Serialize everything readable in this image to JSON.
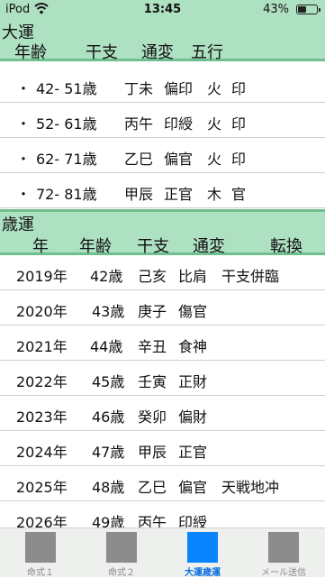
{
  "status_bar": {
    "carrier": "iPod",
    "time": "13:45",
    "battery_percent": "43%",
    "battery_level": 0.43,
    "wifi_icon": "wifi-icon",
    "battery_icon": "battery-icon"
  },
  "major_luck": {
    "title": "大運",
    "headers": [
      "年齢",
      "干支",
      "通変",
      "五行"
    ],
    "rows": [
      {
        "bullet": "・",
        "age": "42- 51歳",
        "kanshi": "丁未",
        "tsuhen": "偏印",
        "gogyo1": "火",
        "gogyo2": "印"
      },
      {
        "bullet": "・",
        "age": "52- 61歳",
        "kanshi": "丙午",
        "tsuhen": "印綬",
        "gogyo1": "火",
        "gogyo2": "印"
      },
      {
        "bullet": "・",
        "age": "62- 71歳",
        "kanshi": "乙巳",
        "tsuhen": "偏官",
        "gogyo1": "火",
        "gogyo2": "印"
      },
      {
        "bullet": "・",
        "age": "72- 81歳",
        "kanshi": "甲辰",
        "tsuhen": "正官",
        "gogyo1": "木",
        "gogyo2": "官"
      }
    ]
  },
  "annual_luck": {
    "title": "歳運",
    "headers": [
      "年",
      "年齢",
      "干支",
      "通変",
      "転換"
    ],
    "rows": [
      {
        "year": "2019年",
        "age": "42歳",
        "kanshi": "己亥",
        "tsuhen": "比肩",
        "tenkan": "干支併臨"
      },
      {
        "year": "2020年",
        "age": "43歳",
        "kanshi": "庚子",
        "tsuhen": "傷官",
        "tenkan": ""
      },
      {
        "year": "2021年",
        "age": "44歳",
        "kanshi": "辛丑",
        "tsuhen": "食神",
        "tenkan": ""
      },
      {
        "year": "2022年",
        "age": "45歳",
        "kanshi": "壬寅",
        "tsuhen": "正財",
        "tenkan": ""
      },
      {
        "year": "2023年",
        "age": "46歳",
        "kanshi": "癸卯",
        "tsuhen": "偏財",
        "tenkan": ""
      },
      {
        "year": "2024年",
        "age": "47歳",
        "kanshi": "甲辰",
        "tsuhen": "正官",
        "tenkan": ""
      },
      {
        "year": "2025年",
        "age": "48歳",
        "kanshi": "乙巳",
        "tsuhen": "偏官",
        "tenkan": "天戦地冲"
      },
      {
        "year": "2026年",
        "age": "49歳",
        "kanshi": "丙午",
        "tsuhen": "印綬",
        "tenkan": ""
      }
    ]
  },
  "tab_bar": {
    "tabs": [
      {
        "label": "命式１",
        "icon": "chart1-icon"
      },
      {
        "label": "命式２",
        "icon": "chart2-icon"
      },
      {
        "label": "大運歳運",
        "icon": "luck-icon"
      },
      {
        "label": "メール送信",
        "icon": "mail-icon"
      }
    ],
    "active_index": 2
  },
  "colors": {
    "header_bg": "#aee0c2",
    "header_border": "#6fc08f",
    "tab_active": "#0a84ff"
  }
}
